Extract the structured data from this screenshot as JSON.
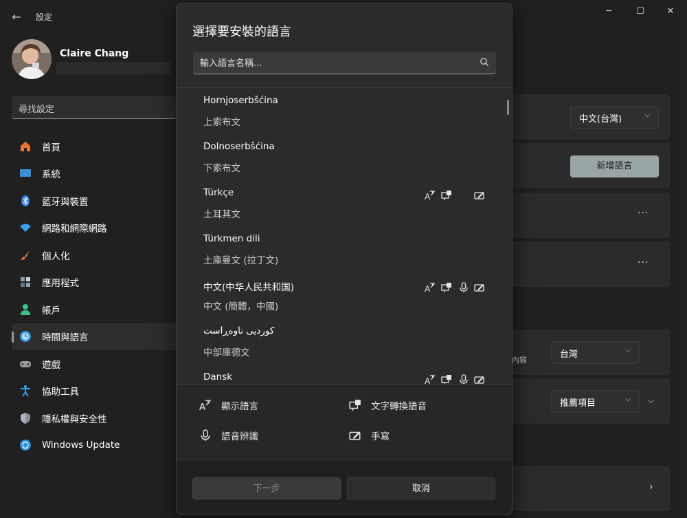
{
  "window": {
    "title": "設定",
    "back_icon": "←",
    "minimize_icon": "─",
    "maximize_icon": "☐",
    "close_icon": "✕"
  },
  "profile": {
    "name": "Claire Chang"
  },
  "search": {
    "placeholder": "尋找設定"
  },
  "sidebar": {
    "items": [
      {
        "label": "首頁",
        "icon": "home-icon",
        "color": "#e8753a"
      },
      {
        "label": "系統",
        "icon": "system-icon",
        "color": "#3a8fd8"
      },
      {
        "label": "藍牙與裝置",
        "icon": "bluetooth-icon",
        "color": "#2f7fe0"
      },
      {
        "label": "網路和網際網路",
        "icon": "wifi-icon",
        "color": "#3aa0e8"
      },
      {
        "label": "個人化",
        "icon": "brush-icon",
        "color": "#e0a050"
      },
      {
        "label": "應用程式",
        "icon": "apps-icon",
        "color": "#8aa0b8"
      },
      {
        "label": "帳戶",
        "icon": "account-icon",
        "color": "#3ec08a"
      },
      {
        "label": "時間與語言",
        "icon": "time-language-icon",
        "color": "#3a9ae0"
      },
      {
        "label": "遊戲",
        "icon": "gaming-icon",
        "color": "#9a9a9a"
      },
      {
        "label": "協助工具",
        "icon": "accessibility-icon",
        "color": "#3aa0e8"
      },
      {
        "label": "隱私權與安全性",
        "icon": "shield-icon",
        "color": "#8a8f98"
      },
      {
        "label": "Windows Update",
        "icon": "update-icon",
        "color": "#2f8fe0"
      }
    ],
    "active_index": 7
  },
  "content": {
    "display_language_value": "中文(台灣)",
    "add_language_label": "新增語言",
    "more_label": "···",
    "region_note": "內容",
    "region_value": "台灣",
    "format_value": "推薦項目"
  },
  "dialog": {
    "title": "選擇要安裝的語言",
    "search_placeholder": "輸入語言名稱...",
    "languages": [
      {
        "native": "Hornjoserbšćina",
        "local": "上索布文",
        "features": []
      },
      {
        "native": "Dolnoserbšćina",
        "local": "下索布文",
        "features": []
      },
      {
        "native": "Türkçe",
        "local": "土耳其文",
        "features": [
          "display",
          "tts",
          "handwriting"
        ]
      },
      {
        "native": "Türkmen dili",
        "local": "土庫曼文 (拉丁文)",
        "features": []
      },
      {
        "native": "中文(中华人民共和国)",
        "local": "中文 (簡體，中國)",
        "features": [
          "display",
          "tts",
          "speech",
          "handwriting"
        ]
      },
      {
        "native": "کوردیی ناوەڕاست",
        "local": "中部庫德文",
        "features": []
      },
      {
        "native": "Dansk",
        "local": "",
        "features": [
          "display",
          "tts",
          "speech",
          "handwriting"
        ]
      }
    ],
    "legend": {
      "display": "顯示語言",
      "tts": "文字轉換語音",
      "speech": "語音辨識",
      "handwriting": "手寫"
    },
    "next_label": "下一步",
    "cancel_label": "取消"
  }
}
